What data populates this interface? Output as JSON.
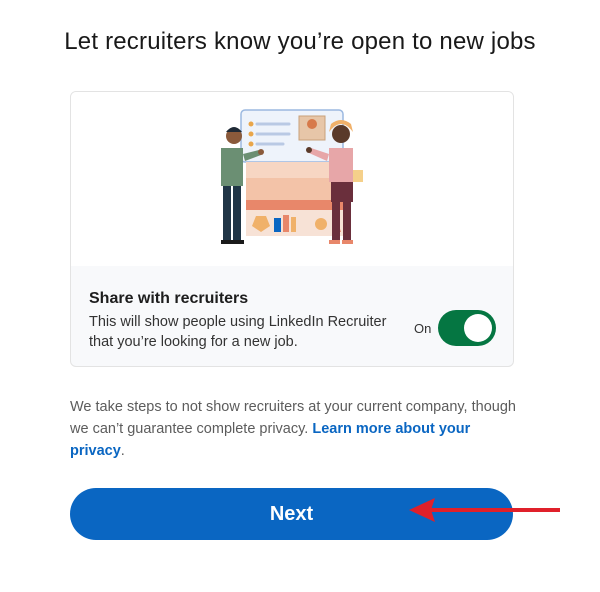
{
  "title": "Let recruiters know you’re open to new jobs",
  "card": {
    "heading": "Share with recruiters",
    "description": "This will show people using LinkedIn Recruiter that you’re looking for a new job.",
    "toggle_label": "On",
    "toggle_on": true
  },
  "privacy": {
    "text": "We take steps to not show recruiters at your current company, though we can’t guarantee complete privacy. ",
    "link": "Learn more about your privacy",
    "suffix": "."
  },
  "next_button": "Next",
  "colors": {
    "primary": "#0a66c2",
    "toggle_on": "#057642",
    "annotation_arrow": "#e0202a"
  },
  "icons": [
    "recruiter-illustration",
    "annotation-arrow-icon"
  ]
}
